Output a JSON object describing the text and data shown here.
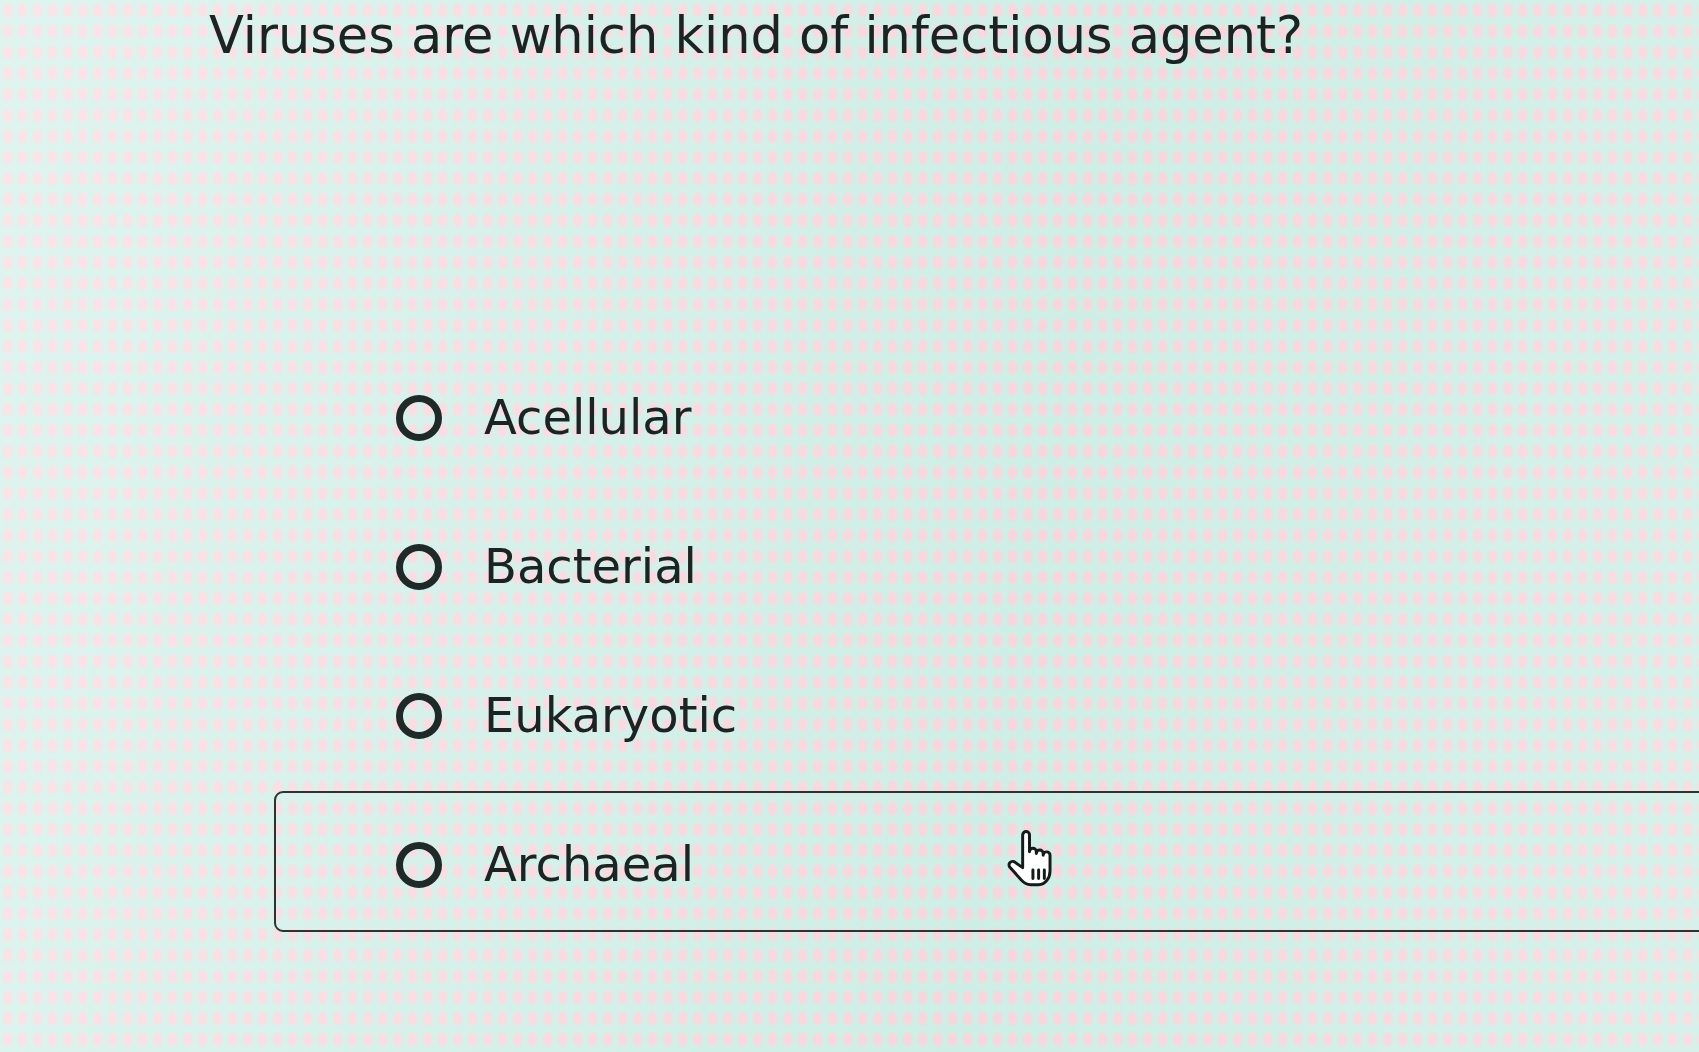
{
  "question": "Viruses are which kind of infectious agent?",
  "options": [
    {
      "label": "Acellular",
      "selected": false,
      "hovered": false
    },
    {
      "label": "Bacterial",
      "selected": false,
      "hovered": false
    },
    {
      "label": "Eukaryotic",
      "selected": false,
      "hovered": false
    },
    {
      "label": "Archaeal",
      "selected": false,
      "hovered": true
    }
  ]
}
